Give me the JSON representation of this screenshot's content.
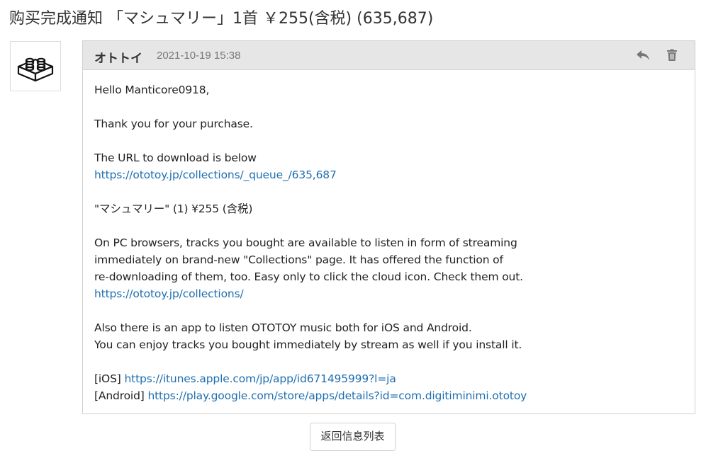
{
  "page": {
    "title": "购买完成通知 「マシュマリー」1首 ￥255(含税) (635,687)"
  },
  "sender": {
    "avatar_icon": "lego-brick-icon",
    "name": "オトトイ",
    "date": "2021-10-19 15:38"
  },
  "actions": {
    "reply_icon": "reply-icon",
    "delete_icon": "trash-icon"
  },
  "body": {
    "greeting": "Hello Manticore0918,",
    "thanks": "Thank you for your purchase.",
    "download_intro": "The URL to download is below",
    "download_url": "https://ototoy.jp/collections/_queue_/635,687",
    "item_line": "\"マシュマリー\" (1) ¥255 (含税)",
    "collections_line1": "On PC browsers, tracks you bought are available to listen in form of streaming",
    "collections_line2": "immediately on brand-new \"Collections\" page. It has offered the function of",
    "collections_line3": "re-downloading of them, too. Easy only to click the cloud icon. Check them out.",
    "collections_url": "https://ototoy.jp/collections/",
    "app_line1": "Also there is an app to listen OTOTOY music both for iOS and Android.",
    "app_line2": "You can enjoy tracks you bought immediately by stream as well if you install it.",
    "ios_label": "[iOS]",
    "ios_url": "https://itunes.apple.com/jp/app/id671495999?l=ja",
    "android_label": "[Android]",
    "android_url": "https://play.google.com/store/apps/details?id=com.digitiminimi.ototoy"
  },
  "footer": {
    "back_label": "返回信息列表"
  },
  "colors": {
    "link": "#1f6fb0",
    "header_bg": "#e6e6e6",
    "border": "#d0d0d0"
  }
}
